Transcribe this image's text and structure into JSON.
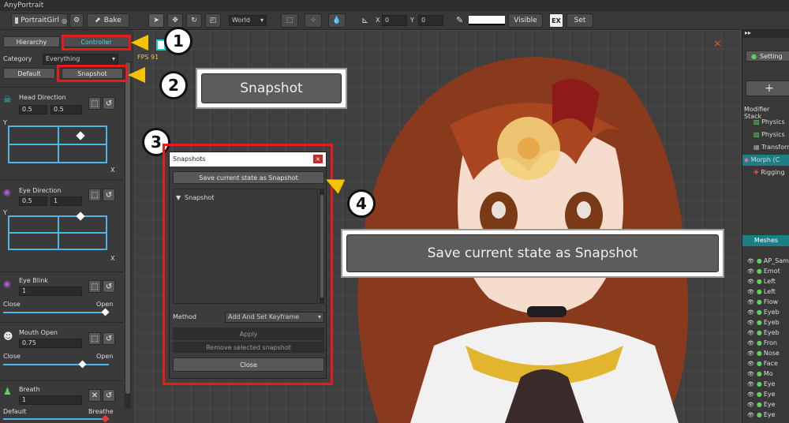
{
  "app": {
    "title": "AnyPortrait"
  },
  "toolbar": {
    "object_label": "PortraitGirl",
    "bake_label": "Bake",
    "space_label": "World",
    "x_label": "X",
    "x_value": "0",
    "y_label": "Y",
    "y_value": "0",
    "visible_label": "Visible",
    "set_label": "Set"
  },
  "left_panel": {
    "tab_hierarchy": "Hierarchy",
    "tab_controller": "Controller",
    "category_label": "Category",
    "category_value": "Everything",
    "default_button": "Default",
    "snapshot_button": "Snapshot",
    "controls": [
      {
        "name": "Head Direction",
        "v1": "0.5",
        "v2": "0.5",
        "axis_y": "Y",
        "axis_x": "X"
      },
      {
        "name": "Eye Direction",
        "v1": "0.5",
        "v2": "1",
        "axis_y": "Y",
        "axis_x": "X"
      },
      {
        "name": "Eye Blink",
        "v1": "1",
        "min": "Close",
        "max": "Open"
      },
      {
        "name": "Mouth Open",
        "v1": "0.75",
        "min": "Close",
        "max": "Open"
      },
      {
        "name": "Breath",
        "v1": "1",
        "min": "Default",
        "max": "Breathe"
      }
    ]
  },
  "viewport": {
    "fps": "FPS 91"
  },
  "dialog": {
    "title": "Snapshots",
    "save_button": "Save current state as Snapshot",
    "list_header": "Snapshot",
    "method_label": "Method",
    "method_value": "Add And Set Keyframe",
    "apply_button": "Apply",
    "remove_button": "Remove selected snapshot",
    "close_button": "Close"
  },
  "callouts": {
    "snapshot": "Snapshot",
    "save": "Save current state as Snapshot",
    "marker1": "1",
    "marker2": "2",
    "marker3": "3",
    "marker4": "4"
  },
  "right_panel": {
    "setting_label": "Setting",
    "modifier_stack_label": "Modifier Stack",
    "modifiers": [
      "Physics",
      "Physics",
      "Transform",
      "Morph (C",
      "Rigging"
    ],
    "meshes_label": "Meshes",
    "meshes": [
      "AP_Sam",
      "Emot",
      "Left",
      "Left",
      "Flow",
      "Eyeb",
      "Eyeb",
      "Eyeb",
      "Fron",
      "Nose",
      "Face",
      "Mo",
      "Eye",
      "Eye",
      "Eye",
      "Eye"
    ]
  },
  "colors": {
    "accent": "#28c3c3",
    "callout_red": "#e41c1c",
    "arrow_yellow": "#f5c400"
  }
}
